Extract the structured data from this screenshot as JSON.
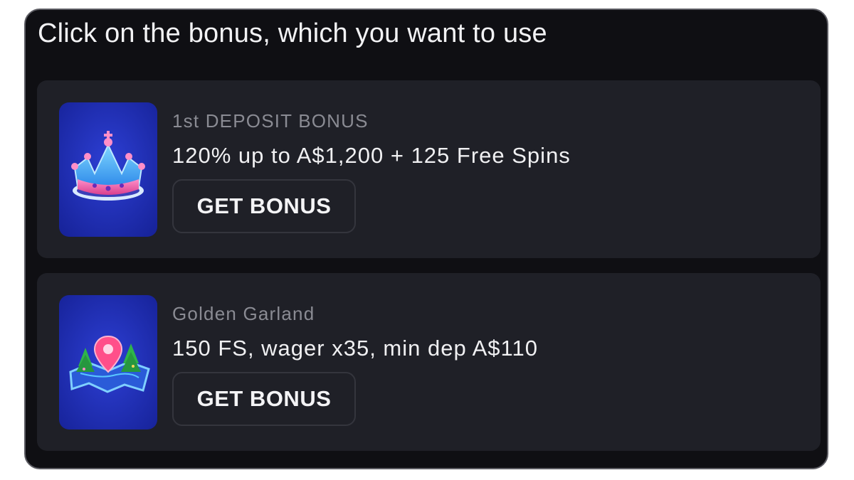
{
  "header": {
    "title": "Click on the bonus, which you want to use"
  },
  "bonuses": [
    {
      "label": "1st DEPOSIT BONUS",
      "description": "120% up to A$1,200 + 125 Free Spins",
      "button_label": "GET BONUS",
      "icon": "crown-icon"
    },
    {
      "label": "Golden Garland",
      "description": "150 FS, wager x35, min dep A$110",
      "button_label": "GET BONUS",
      "icon": "map-pin-icon"
    }
  ],
  "colors": {
    "panel_bg": "#0f0f13",
    "card_bg": "#1f2027",
    "thumb_bg": "#1a2aa8",
    "text_primary": "#f0f0f2",
    "text_muted": "#8a8b93"
  }
}
